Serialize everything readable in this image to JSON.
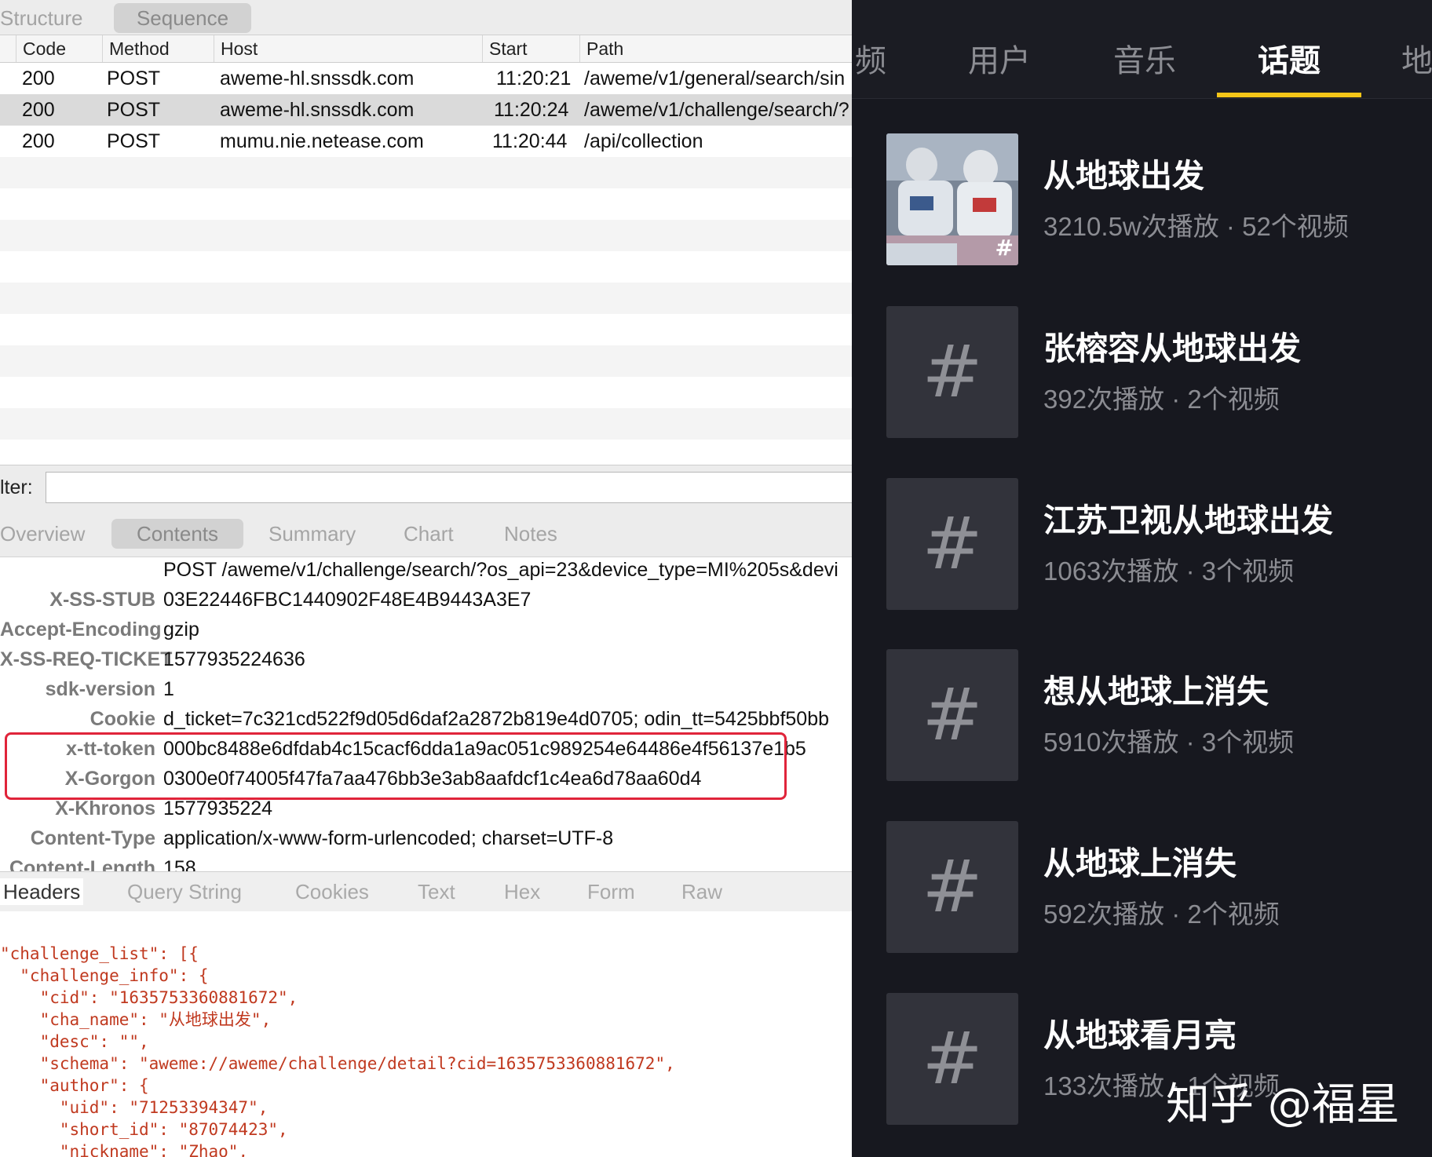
{
  "left": {
    "top_tabs": [
      "Structure",
      "Sequence"
    ],
    "columns": [
      "Code",
      "Method",
      "Host",
      "Start",
      "Path"
    ],
    "requests": [
      {
        "code": "200",
        "method": "POST",
        "host": "aweme-hl.snssdk.com",
        "start": "11:20:21",
        "path": "/aweme/v1/general/search/sin"
      },
      {
        "code": "200",
        "method": "POST",
        "host": "aweme-hl.snssdk.com",
        "start": "11:20:24",
        "path": "/aweme/v1/challenge/search/?"
      },
      {
        "code": "200",
        "method": "POST",
        "host": "mumu.nie.netease.com",
        "start": "11:20:44",
        "path": "/api/collection"
      }
    ],
    "filter_label": "lter:",
    "section_tabs": [
      "Overview",
      "Contents",
      "Summary",
      "Chart",
      "Notes"
    ],
    "request_line": "POST /aweme/v1/challenge/search/?os_api=23&device_type=MI%205s&devi",
    "headers": [
      {
        "key": "X-SS-STUB",
        "value": "03E22446FBC1440902F48E4B9443A3E7"
      },
      {
        "key": "Accept-Encoding",
        "value": "gzip"
      },
      {
        "key": "X-SS-REQ-TICKET",
        "value": "1577935224636"
      },
      {
        "key": "sdk-version",
        "value": "1"
      },
      {
        "key": "Cookie",
        "value": "d_ticket=7c321cd522f9d05d6daf2a2872b819e4d0705; odin_tt=5425bbf50bb"
      },
      {
        "key": "x-tt-token",
        "value": "000bc8488e6dfdab4c15cacf6dda1a9ac051c989254e64486e4f56137e1b5"
      },
      {
        "key": "X-Gorgon",
        "value": "0300e0f74005f47fa7aa476bb3e3ab8aafdcf1c4ea6d78aa60d4"
      },
      {
        "key": "X-Khronos",
        "value": "1577935224"
      },
      {
        "key": "Content-Type",
        "value": "application/x-www-form-urlencoded; charset=UTF-8"
      },
      {
        "key": "Content-Length",
        "value": "158"
      }
    ],
    "bottom_tabs": [
      "Headers",
      "Query String",
      "Cookies",
      "Text",
      "Hex",
      "Form",
      "Raw"
    ],
    "json_lines": [
      "\"challenge_list\": [{",
      "  \"challenge_info\": {",
      "    \"cid\": \"1635753360881672\",",
      "    \"cha_name\": \"从地球出发\",",
      "    \"desc\": \"\",",
      "    \"schema\": \"aweme://aweme/challenge/detail?cid=1635753360881672\",",
      "    \"author\": {",
      "      \"uid\": \"71253394347\",",
      "      \"short_id\": \"87074423\",",
      "      \"nickname\": \"Zhao\","
    ]
  },
  "right": {
    "tabs": [
      "频",
      "用户",
      "音乐",
      "话题",
      "地"
    ],
    "selected_tab": "话题",
    "topics": [
      {
        "title": "从地球出发",
        "meta": "3210.5w次播放 · 52个视频"
      },
      {
        "title": "张榕容从地球出发",
        "meta": "392次播放 · 2个视频"
      },
      {
        "title": "江苏卫视从地球出发",
        "meta": "1063次播放 · 3个视频"
      },
      {
        "title": "想从地球上消失",
        "meta": "5910次播放 · 3个视频"
      },
      {
        "title": "从地球上消失",
        "meta": "592次播放 · 2个视频"
      },
      {
        "title": "从地球看月亮",
        "meta": "133次播放 · 1个视频"
      }
    ],
    "hash_symbol": "#",
    "watermark": "知乎 @福星"
  },
  "colors": {
    "highlight_box": "#e0243a",
    "tab_underline": "#f5c518",
    "json_string": "#c0391f",
    "dark_bg": "#17181f"
  }
}
